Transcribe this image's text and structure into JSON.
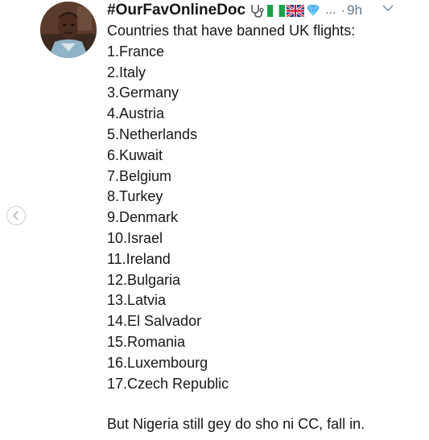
{
  "tweet": {
    "display_name": "#OurFavOnlineDoc",
    "badges": [
      "stethoscope-icon",
      "nigeria-flag-icon",
      "uk-flag-icon",
      "gem-icon"
    ],
    "ellipsis": "...",
    "separator": "·",
    "time": "9h",
    "intro": "Countries that have banned UK flights:",
    "countries": [
      "1.France",
      "2.Italy",
      "3.Germany",
      "4.Austria",
      "5.Netherlands",
      "6.Kuwait",
      "7.Belgium",
      "8.Turkey",
      "9.Denmark",
      "10.Israel",
      "11.Ireland",
      "12.Bulgaria",
      "13.Latvia",
      "14.El Salvador",
      "15.Romania",
      "16.Luxembourg",
      "17.Czech Republic"
    ],
    "closing": "But Nigeria still gey do sho ni CC, fall in."
  },
  "colors": {
    "text": "#14171a",
    "muted": "#657786",
    "gem": "#4ab3f4"
  }
}
